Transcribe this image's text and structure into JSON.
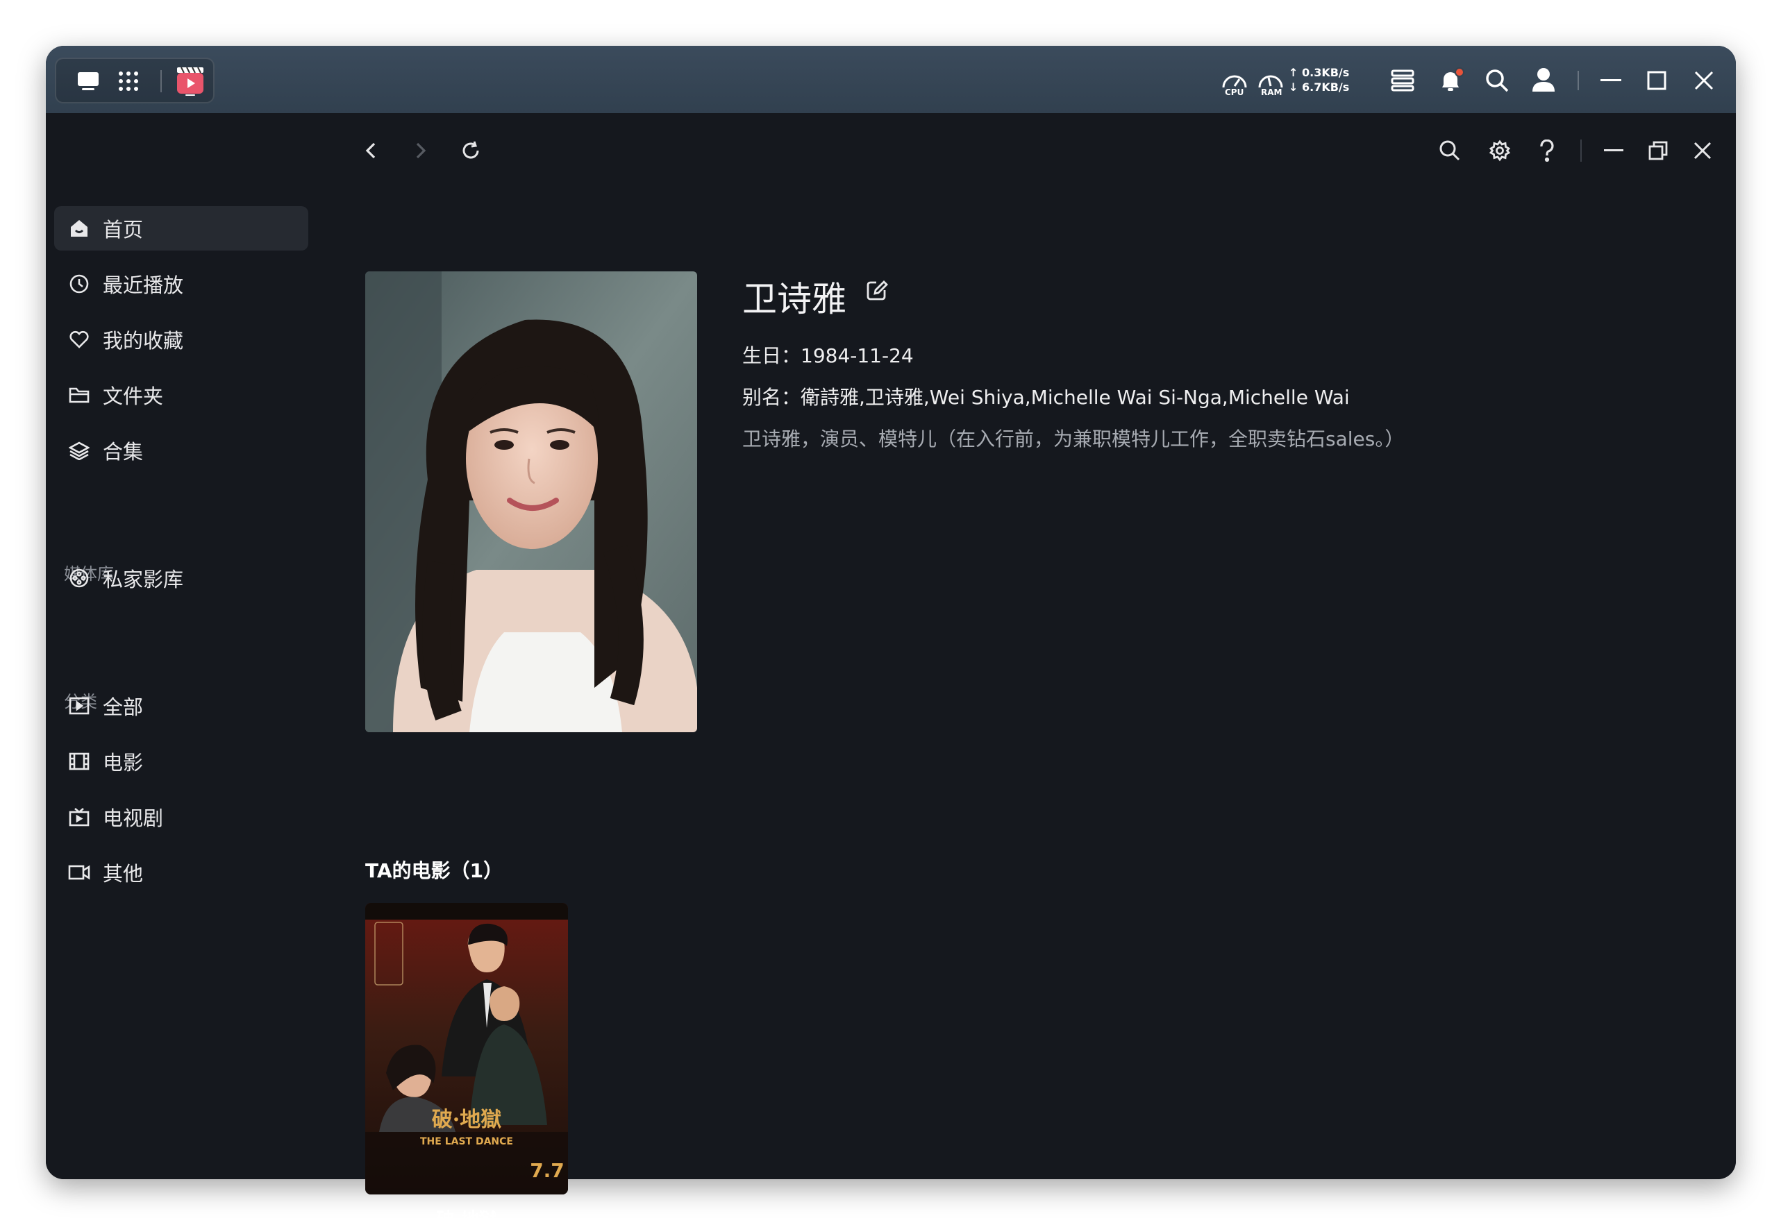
{
  "os": {
    "cpu_label": "CPU",
    "ram_label": "RAM",
    "net_up": "↑ 0.3KB/s",
    "net_down": "↓ 6.7KB/s",
    "notification_dot_color": "#e8533a"
  },
  "sidebar": {
    "items": [
      {
        "label": "首页",
        "icon": "home-icon"
      },
      {
        "label": "最近播放",
        "icon": "clock-icon"
      },
      {
        "label": "我的收藏",
        "icon": "heart-icon"
      },
      {
        "label": "文件夹",
        "icon": "folder-icon"
      },
      {
        "label": "合集",
        "icon": "layers-icon"
      }
    ],
    "library_label": "媒体库",
    "library_items": [
      {
        "label": "私家影库",
        "icon": "film-reel-icon"
      }
    ],
    "category_label": "分类",
    "category_items": [
      {
        "label": "全部",
        "icon": "play-square-icon"
      },
      {
        "label": "电影",
        "icon": "film-icon"
      },
      {
        "label": "电视剧",
        "icon": "tv-icon"
      },
      {
        "label": "其他",
        "icon": "video-camera-icon"
      }
    ]
  },
  "person": {
    "name": "卫诗雅",
    "birthday": "生日：1984-11-24",
    "aliases": "别名：衛詩雅,卫诗雅,Wei Shiya,Michelle Wai Si-Nga,Michelle Wai",
    "bio": "卫诗雅，演员、模特儿（在入行前，为兼职模特儿工作，全职卖钻石sales。）"
  },
  "movies": {
    "section_title": "TA的电影（1）",
    "items": [
      {
        "title": "破·地狱",
        "poster_title": "破·地獄",
        "poster_subtitle": "THE LAST DANCE",
        "poster_date": "7.7"
      }
    ]
  }
}
